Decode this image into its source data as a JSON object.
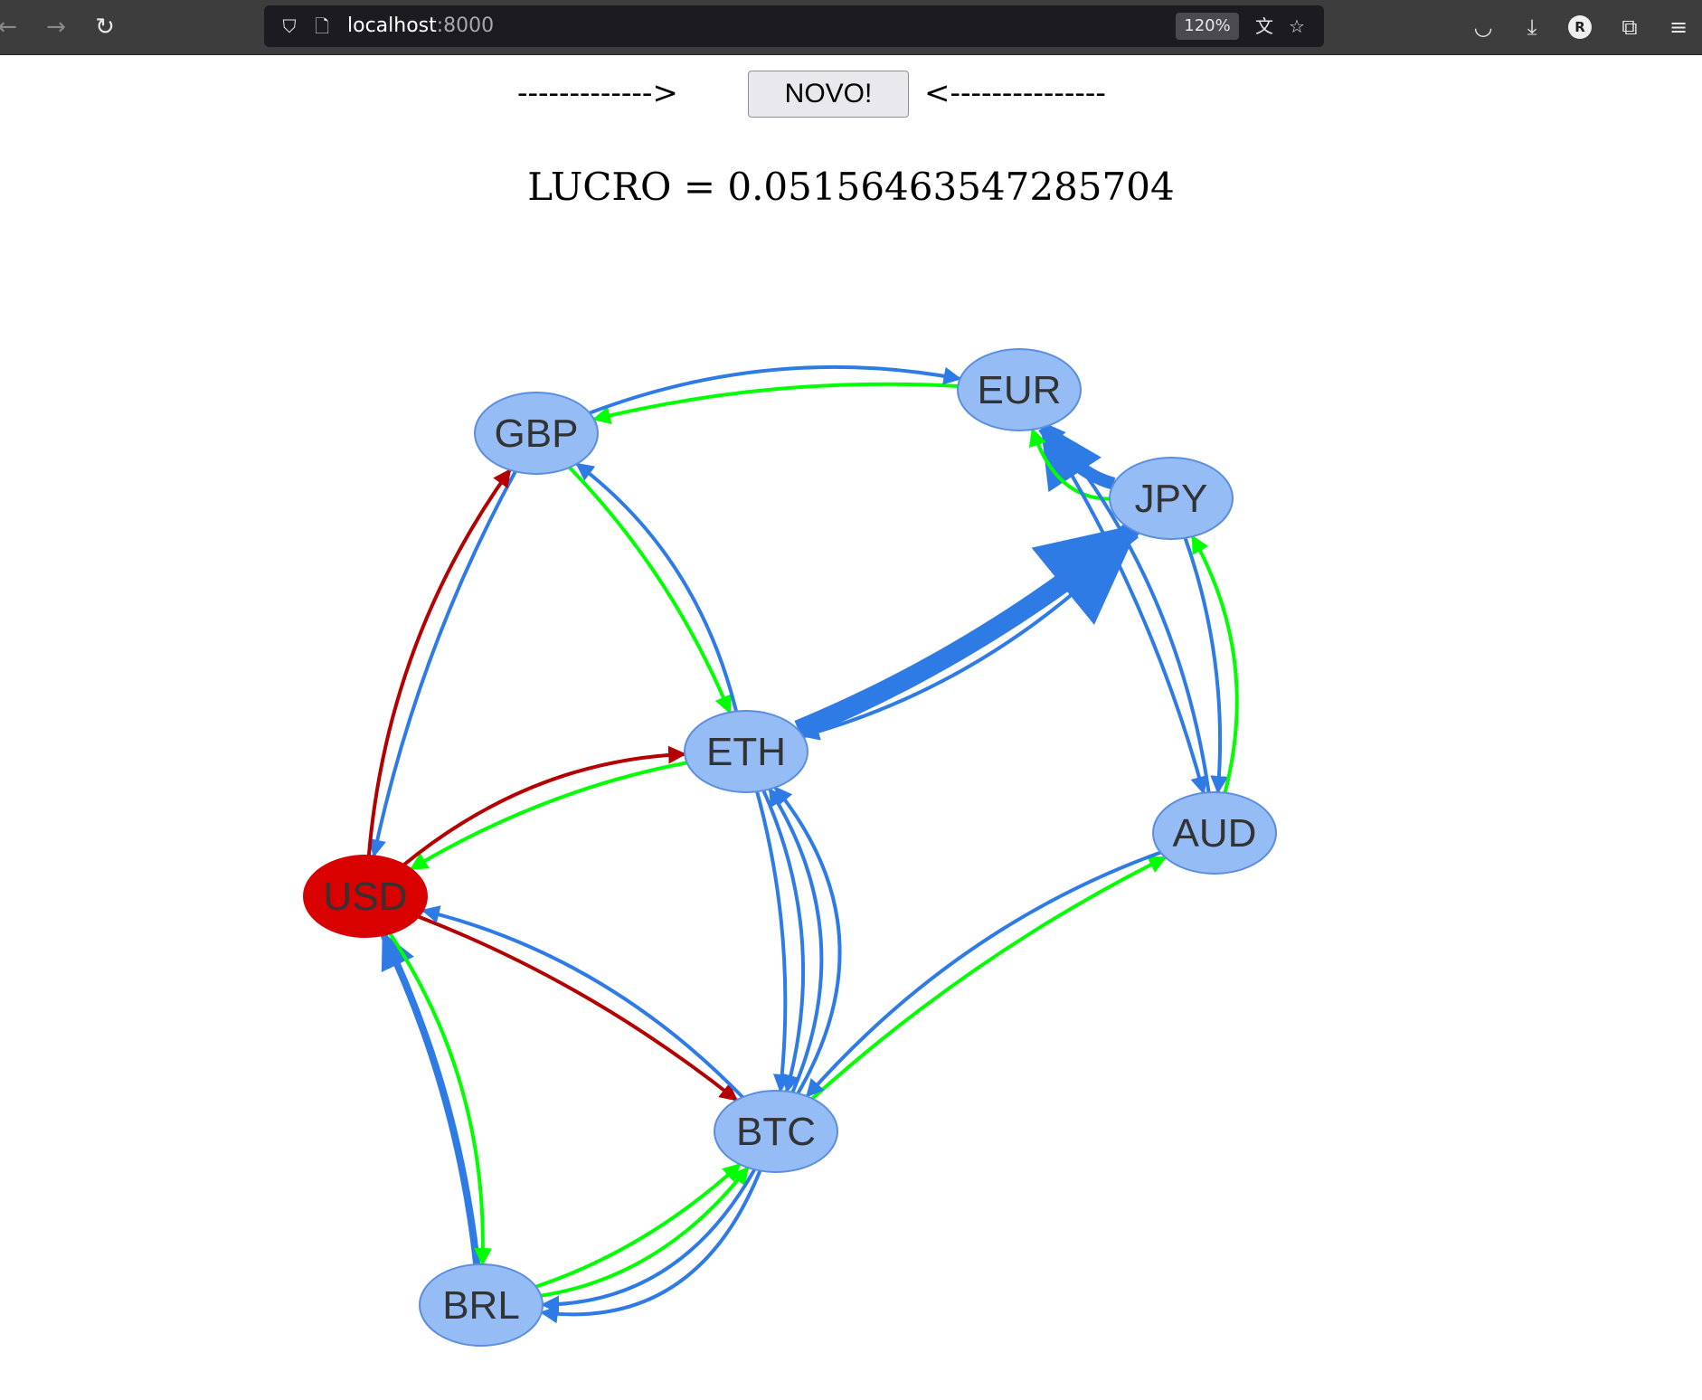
{
  "browser": {
    "url_host": "localhost",
    "url_port": ":8000",
    "zoom": "120%",
    "avatar_letter": "R",
    "icons": [
      "back-icon",
      "forward-icon",
      "reload-icon",
      "shield-icon",
      "page-icon",
      "translate-icon",
      "star-icon",
      "pocket-icon",
      "download-icon",
      "extensions-icon",
      "menu-icon"
    ]
  },
  "page": {
    "left_arrow": "------------->",
    "button_label": "NOVO!",
    "right_arrow": "<---------------",
    "lucro": "LUCRO = 0.05156463547285704"
  },
  "graph": {
    "colors": {
      "node_fill": "#95bcf5",
      "node_stroke": "#5a8ee0",
      "highlight_node": "#d90000",
      "edge_blue": "#2f7be6",
      "edge_green": "#00ff00",
      "edge_red": "#b30000"
    },
    "nodes": [
      {
        "id": "GBP",
        "label": "GBP"
      },
      {
        "id": "EUR",
        "label": "EUR"
      },
      {
        "id": "JPY",
        "label": "JPY"
      },
      {
        "id": "ETH",
        "label": "ETH"
      },
      {
        "id": "AUD",
        "label": "AUD"
      },
      {
        "id": "USD",
        "label": "USD",
        "highlight": true
      },
      {
        "id": "BTC",
        "label": "BTC"
      },
      {
        "id": "BRL",
        "label": "BRL"
      }
    ],
    "edges": [
      {
        "from": "EUR",
        "to": "GBP",
        "color": "green"
      },
      {
        "from": "GBP",
        "to": "EUR",
        "color": "blue"
      },
      {
        "from": "GBP",
        "to": "ETH",
        "color": "green"
      },
      {
        "from": "ETH",
        "to": "GBP",
        "color": "blue"
      },
      {
        "from": "GBP",
        "to": "USD",
        "color": "blue"
      },
      {
        "from": "USD",
        "to": "GBP",
        "color": "red"
      },
      {
        "from": "JPY",
        "to": "EUR",
        "color": "blue"
      },
      {
        "from": "JPY",
        "to": "EUR",
        "color": "green"
      },
      {
        "from": "EUR",
        "to": "AUD",
        "color": "blue"
      },
      {
        "from": "AUD",
        "to": "EUR",
        "color": "blue"
      },
      {
        "from": "ETH",
        "to": "JPY",
        "color": "blue"
      },
      {
        "from": "JPY",
        "to": "ETH",
        "color": "blue"
      },
      {
        "from": "JPY",
        "to": "AUD",
        "color": "blue"
      },
      {
        "from": "AUD",
        "to": "JPY",
        "color": "green"
      },
      {
        "from": "ETH",
        "to": "USD",
        "color": "green"
      },
      {
        "from": "USD",
        "to": "ETH",
        "color": "red"
      },
      {
        "from": "ETH",
        "to": "BTC",
        "color": "blue"
      },
      {
        "from": "ETH",
        "to": "BTC",
        "color": "blue"
      },
      {
        "from": "BTC",
        "to": "ETH",
        "color": "blue"
      },
      {
        "from": "BTC",
        "to": "ETH",
        "color": "blue"
      },
      {
        "from": "USD",
        "to": "BTC",
        "color": "red"
      },
      {
        "from": "BTC",
        "to": "USD",
        "color": "blue"
      },
      {
        "from": "BTC",
        "to": "AUD",
        "color": "green"
      },
      {
        "from": "AUD",
        "to": "BTC",
        "color": "blue"
      },
      {
        "from": "BRL",
        "to": "USD",
        "color": "blue"
      },
      {
        "from": "USD",
        "to": "BRL",
        "color": "green"
      },
      {
        "from": "BRL",
        "to": "BTC",
        "color": "green"
      },
      {
        "from": "BRL",
        "to": "BTC",
        "color": "green"
      },
      {
        "from": "BTC",
        "to": "BRL",
        "color": "blue"
      },
      {
        "from": "BTC",
        "to": "BRL",
        "color": "blue"
      }
    ]
  }
}
